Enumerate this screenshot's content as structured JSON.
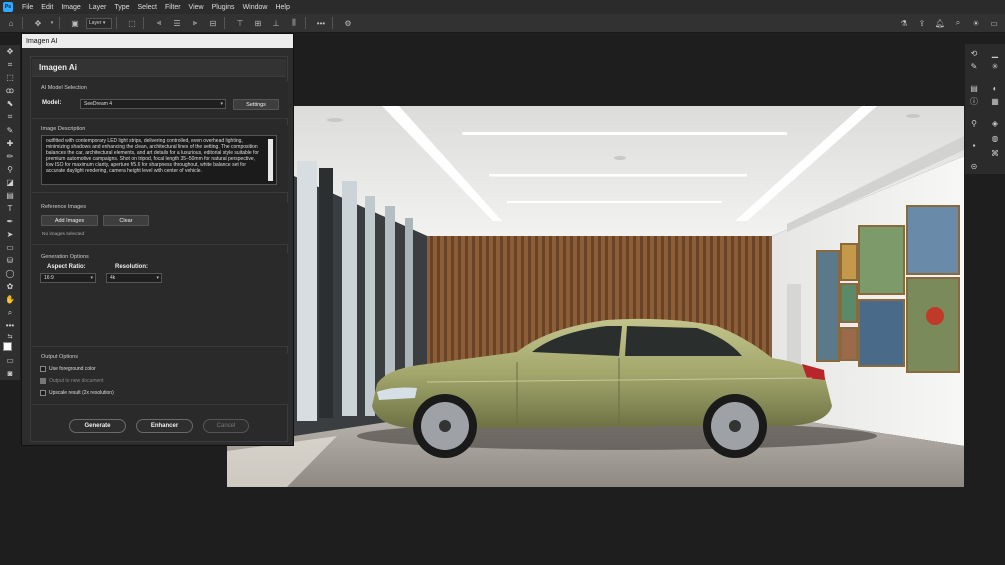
{
  "menubar": {
    "logo": "Ps",
    "items": [
      "File",
      "Edit",
      "Image",
      "Layer",
      "Type",
      "Select",
      "Filter",
      "View",
      "Plugins",
      "Window",
      "Help"
    ]
  },
  "options_bar": {
    "layer_select": "Layer"
  },
  "dialog": {
    "window_title": "Imagen AI",
    "app_title": "Imagen Ai",
    "model_section": {
      "title": "AI Model Selection",
      "model_label": "Model:",
      "model_value": "SeeDream 4",
      "settings_button": "Settings"
    },
    "description_section": {
      "title": "Image Description",
      "text": "outfitted with contemporary LED light strips, delivering controlled, even overhead lighting, minimizing shadows and enhancing the clean, architectural lines of the setting. The composition balances the car, architectural elements, and art details for a luxurious, editorial style suitable for premium automotive campaigns. Shot on tripod, focal length 35–50mm for natural perspective, low ISO for maximum clarity, aperture f/5.6 for sharpness throughout, white balance set for accurate daylight rendering, camera height level with center of vehicle."
    },
    "reference_section": {
      "title": "Reference Images",
      "add_button": "Add Images",
      "clear_button": "Clear",
      "status": "No images selected"
    },
    "generation_section": {
      "title": "Generation Options",
      "aspect_label": "Aspect Ratio:",
      "aspect_value": "16:9",
      "resolution_label": "Resolution:",
      "resolution_value": "4k"
    },
    "output_section": {
      "title": "Output Options",
      "options": [
        {
          "label": "Use foreground color",
          "checked": false,
          "disabled": false
        },
        {
          "label": "Output to new document",
          "checked": false,
          "disabled": true
        },
        {
          "label": "Upscale result (2x resolution)",
          "checked": false,
          "disabled": false
        }
      ]
    },
    "actions": {
      "generate": "Generate",
      "enhancer": "Enhancer",
      "cancel": "Cancel"
    }
  },
  "colors": {
    "accent": "#31a8ff",
    "car_body": "#a3a76c",
    "panel_bg": "#2a2a2a"
  }
}
